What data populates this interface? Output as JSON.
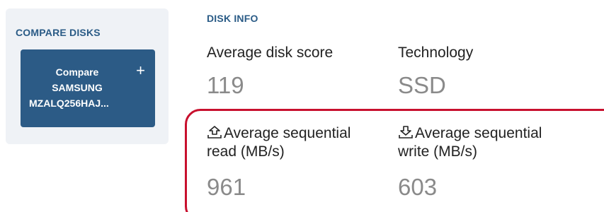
{
  "compare": {
    "title": "COMPARE DISKS",
    "button": {
      "line1": "Compare",
      "line2": "SAMSUNG",
      "line3": "MZALQ256HAJ..."
    }
  },
  "disk_info": {
    "title": "DISK INFO",
    "score": {
      "label": "Average disk score",
      "value": "119"
    },
    "technology": {
      "label": "Technology",
      "value": "SSD"
    },
    "seq_read": {
      "label_line1": "Average sequential",
      "label_line2": "read (MB/s)",
      "value": "961",
      "icon": "upload-icon"
    },
    "seq_write": {
      "label_line1": "Average sequential",
      "label_line2": "write (MB/s)",
      "value": "603",
      "icon": "download-icon"
    }
  },
  "colors": {
    "heading": "#2a5b86",
    "button_bg": "#2c5b86",
    "panel_bg": "#eff2f6",
    "highlight": "#c8102e",
    "value_gray": "#8a8a8a"
  }
}
